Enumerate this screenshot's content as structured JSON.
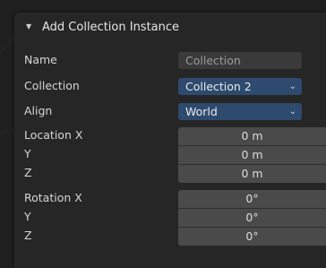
{
  "panel": {
    "title": "Add Collection Instance",
    "expanded": true
  },
  "fields": {
    "name": {
      "label": "Name",
      "value": "Collection"
    },
    "collection": {
      "label": "Collection",
      "value": "Collection 2"
    },
    "align": {
      "label": "Align",
      "value": "World"
    },
    "location": {
      "x_label": "Location X",
      "y_label": "Y",
      "z_label": "Z",
      "x": "0 m",
      "y": "0 m",
      "z": "0 m"
    },
    "rotation": {
      "x_label": "Rotation X",
      "y_label": "Y",
      "z_label": "Z",
      "x": "0°",
      "y": "0°",
      "z": "0°"
    }
  },
  "colors": {
    "panel_bg": "#262626",
    "enum_accent": "#2e4a6e",
    "number_field": "#4a4a4a",
    "text_field": "#3a3a3a"
  },
  "icons": {
    "collapse": "triangle-down-icon",
    "dropdown": "chevron-down-icon"
  }
}
